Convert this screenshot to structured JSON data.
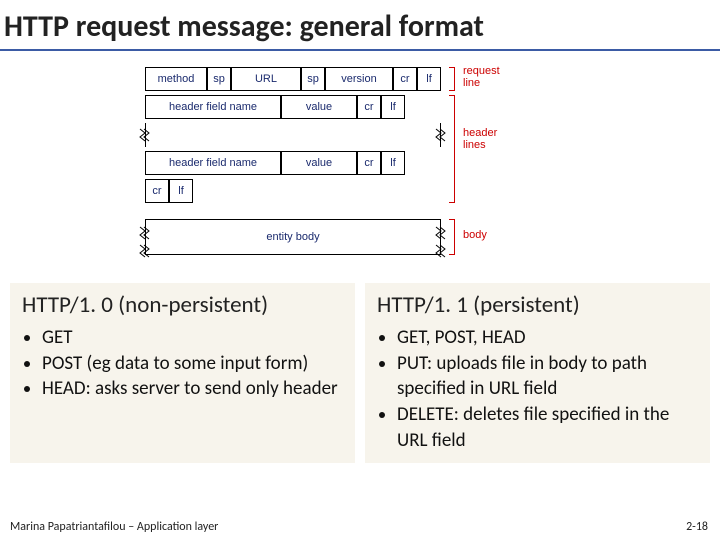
{
  "title": "HTTP request message: general format",
  "diagram": {
    "row1": {
      "method": "method",
      "sp1": "sp",
      "url": "URL",
      "sp2": "sp",
      "version": "version",
      "cr": "cr",
      "lf": "lf"
    },
    "row2": {
      "hfn": "header field name",
      "value": "value",
      "cr": "cr",
      "lf": "lf"
    },
    "row3": {
      "hfn": "header field name",
      "value": "value",
      "cr": "cr",
      "lf": "lf"
    },
    "row4": {
      "cr": "cr",
      "lf": "lf"
    },
    "row5": {
      "body": "entity body"
    },
    "labels": {
      "request_line": "request\nline",
      "header_lines": "header\nlines",
      "body": "body"
    }
  },
  "left": {
    "title": "HTTP/1. 0 (non-persistent)",
    "items": [
      "GET",
      "POST (eg data to some input form)",
      "HEAD: asks server to send only header"
    ]
  },
  "right": {
    "title": "HTTP/1. 1 (persistent)",
    "items": [
      "GET, POST, HEAD",
      "PUT: uploads file in body to path specified in URL field",
      "DELETE: deletes file specified in the URL field"
    ]
  },
  "footer": {
    "left": "Marina Papatriantafilou –  Application layer",
    "right": "2-18"
  }
}
